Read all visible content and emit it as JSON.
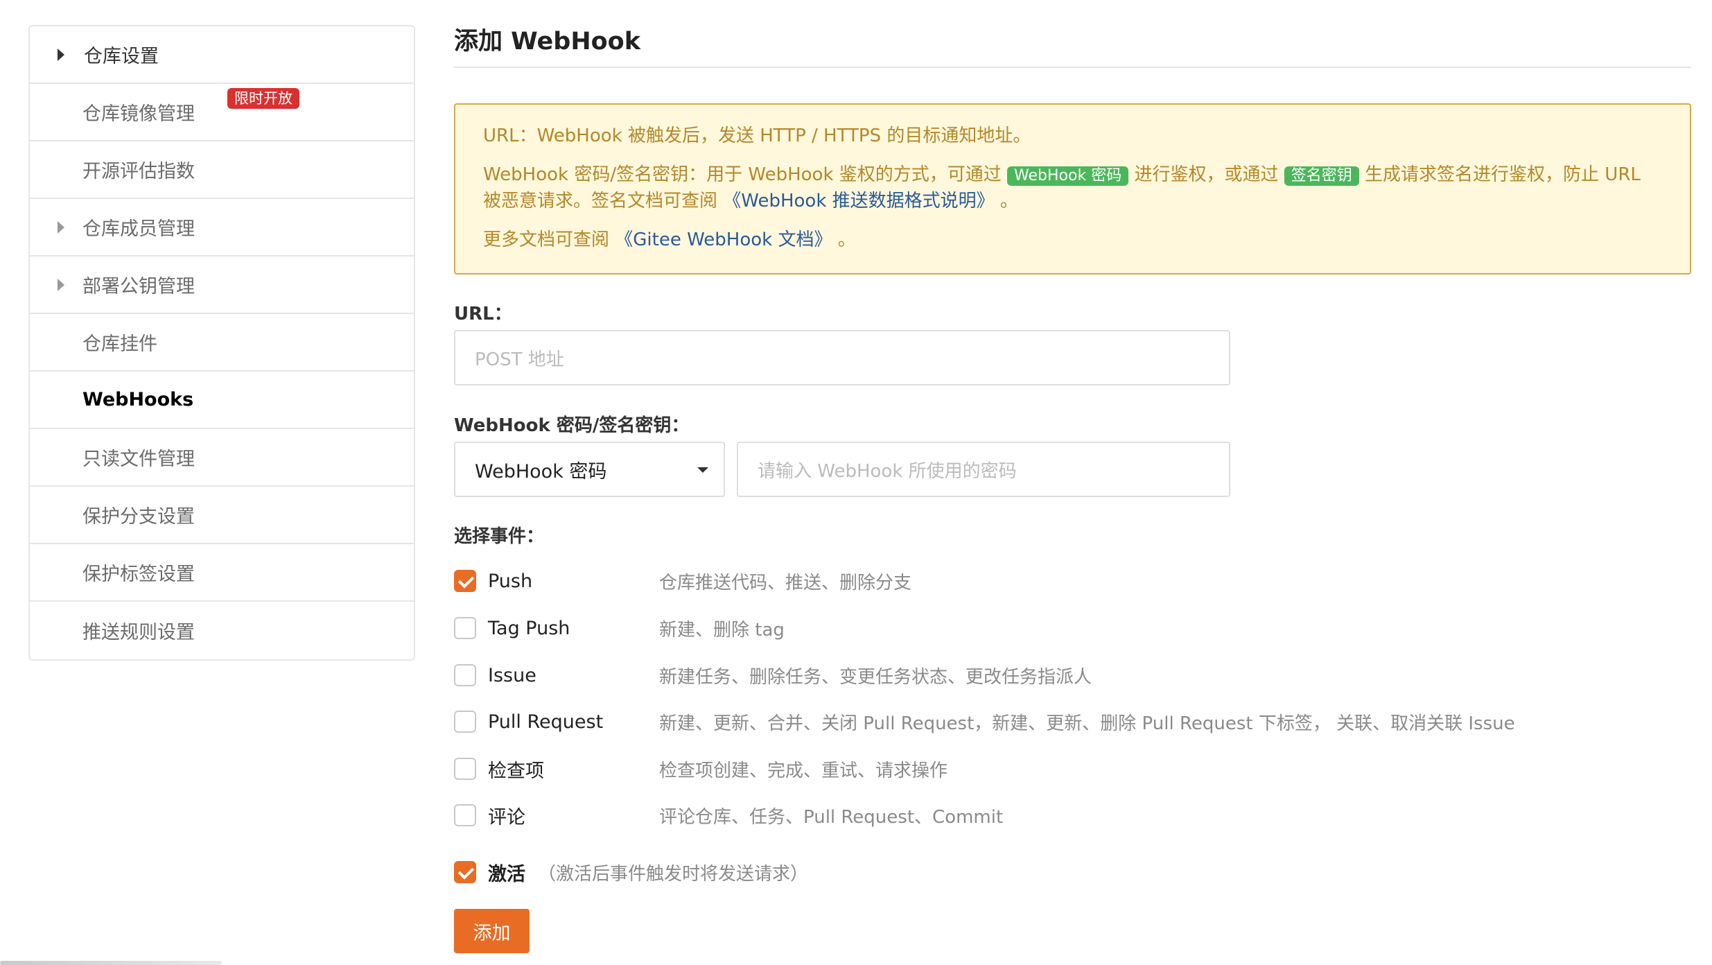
{
  "sidebar": {
    "items": [
      {
        "label": "仓库设置"
      },
      {
        "label": "仓库镜像管理",
        "badge": "限时开放"
      },
      {
        "label": "开源评估指数"
      },
      {
        "label": "仓库成员管理"
      },
      {
        "label": "部署公钥管理"
      },
      {
        "label": "仓库挂件"
      },
      {
        "label": "WebHooks"
      },
      {
        "label": "只读文件管理"
      },
      {
        "label": "保护分支设置"
      },
      {
        "label": "保护标签设置"
      },
      {
        "label": "推送规则设置"
      }
    ]
  },
  "main": {
    "title": "添加 WebHook",
    "notice": {
      "line1": "URL：WebHook 被触发后，发送 HTTP / HTTPS 的目标通知地址。",
      "line2_a": "WebHook 密码/签名密钥：用于 WebHook 鉴权的方式，可通过",
      "tag1": "WebHook 密码",
      "line2_b": "进行鉴权，或通过",
      "tag2": "签名密钥",
      "line2_c": "生成请求签名进行鉴权，防止 URL 被恶意请求。签名文档可查阅",
      "line2_link": "《WebHook 推送数据格式说明》",
      "line2_end": "。",
      "line3_a": "更多文档可查阅",
      "line3_link": "《Gitee WebHook 文档》",
      "line3_end": "。"
    },
    "url_label": "URL：",
    "url_placeholder": "POST 地址",
    "secret_label": "WebHook 密码/签名密钥：",
    "secret_select_value": "WebHook 密码",
    "secret_placeholder": "请输入 WebHook 所使用的密码",
    "events_label": "选择事件：",
    "events": [
      {
        "name": "Push",
        "desc": "仓库推送代码、推送、删除分支",
        "checked": true
      },
      {
        "name": "Tag Push",
        "desc": "新建、删除 tag",
        "checked": false
      },
      {
        "name": "Issue",
        "desc": "新建任务、删除任务、变更任务状态、更改任务指派人",
        "checked": false
      },
      {
        "name": "Pull Request",
        "desc": "新建、更新、合并、关闭 Pull Request，新建、更新、删除 Pull Request 下标签， 关联、取消关联 Issue",
        "checked": false
      },
      {
        "name": "检查项",
        "desc": "检查项创建、完成、重试、请求操作",
        "checked": false
      },
      {
        "name": "评论",
        "desc": "评论仓库、任务、Pull Request、Commit",
        "checked": false
      }
    ],
    "activate_label": "激活",
    "activate_hint": "（激活后事件触发时将发送请求）",
    "activate_checked": true,
    "add_button": "添加"
  },
  "colors": {
    "accent": "#e96c24",
    "notice_bg": "#fff8dc",
    "notice_border": "#d9a84a",
    "notice_text": "#b5872a",
    "link": "#2a5a9c",
    "tag_green": "#4bb75b",
    "badge_red": "#d9312f"
  }
}
